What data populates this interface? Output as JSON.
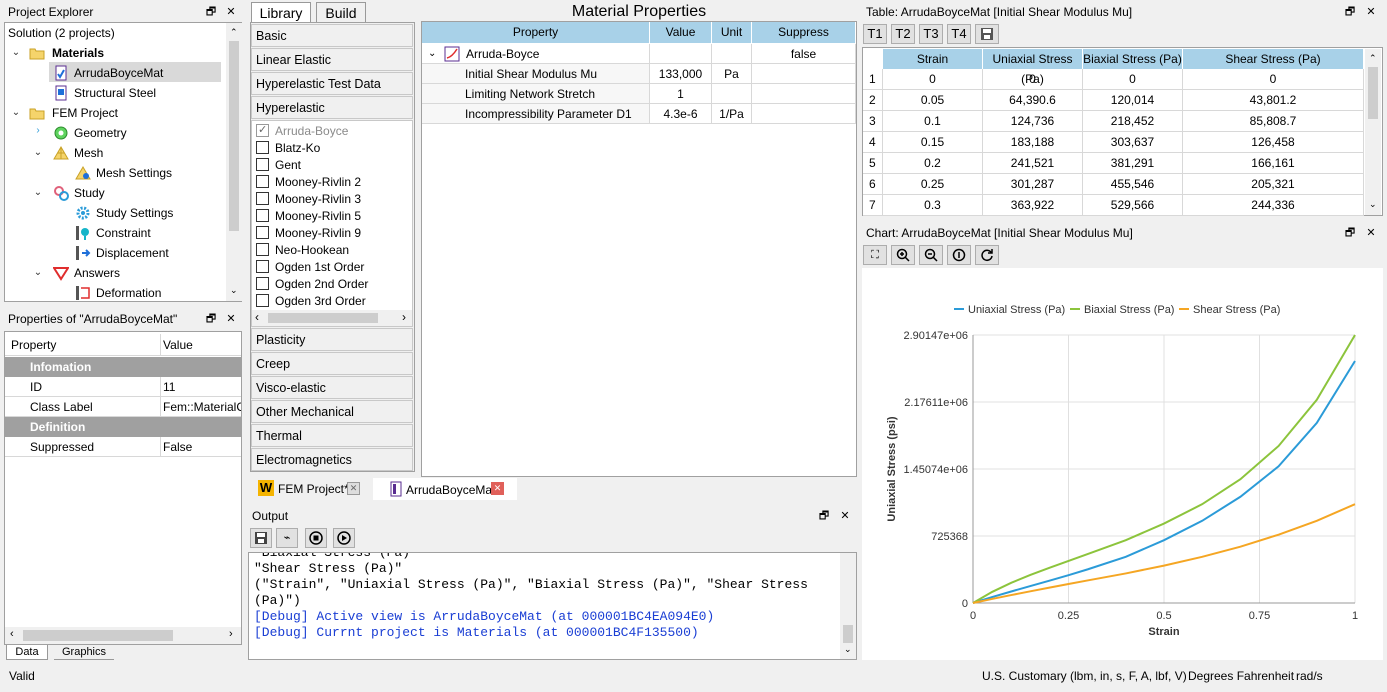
{
  "explorer": {
    "title": "Project Explorer",
    "root": "Solution (2 projects)",
    "materials": "Materials",
    "mat1": "ArrudaBoyceMat",
    "mat2": "Structural Steel",
    "fem": "FEM Project",
    "geometry": "Geometry",
    "mesh": "Mesh",
    "mesh_settings": "Mesh Settings",
    "study": "Study",
    "study_settings": "Study Settings",
    "constraint": "Constraint",
    "displacement": "Displacement",
    "answers": "Answers",
    "deformation": "Deformation"
  },
  "props": {
    "title": "Properties of \"ArrudaBoyceMat\"",
    "col_property": "Property",
    "col_value": "Value",
    "group1": "Infomation",
    "id_label": "ID",
    "id_value": "11",
    "class_label": "Class Label",
    "class_value": "Fem::MaterialC",
    "group2": "Definition",
    "suppressed_label": "Suppressed",
    "suppressed_value": "False",
    "tab_data": "Data",
    "tab_graphics": "Graphics"
  },
  "library": {
    "tab_library": "Library",
    "tab_build": "Build",
    "cats_top": [
      "Basic",
      "Linear Elastic",
      "Hyperelastic Test Data",
      "Hyperelastic"
    ],
    "models": [
      "Arruda-Boyce",
      "Blatz-Ko",
      "Gent",
      "Mooney-Rivlin 2",
      "Mooney-Rivlin 3",
      "Mooney-Rivlin 5",
      "Mooney-Rivlin 9",
      "Neo-Hookean",
      "Ogden 1st Order",
      "Ogden 2nd Order",
      "Ogden 3rd Order"
    ],
    "cats_bottom": [
      "Plasticity",
      "Creep",
      "Visco-elastic",
      "Other Mechanical",
      "Thermal",
      "Electromagnetics"
    ]
  },
  "matprops": {
    "title": "Material Properties",
    "col_property": "Property",
    "col_value": "Value",
    "col_unit": "Unit",
    "col_suppress": "Suppress",
    "model": "Arruda-Boyce",
    "model_suppress": "false",
    "rows": [
      {
        "name": "Initial Shear Modulus Mu",
        "value": "133,000",
        "unit": "Pa"
      },
      {
        "name": "Limiting Network Stretch",
        "value": "1",
        "unit": ""
      },
      {
        "name": "Incompressibility Parameter D1",
        "value": "4.3e-6",
        "unit": "1/Pa"
      }
    ]
  },
  "doctabs": {
    "tab1": "FEM Project*",
    "tab2": "ArrudaBoyceMat"
  },
  "output": {
    "title": "Output",
    "lines": [
      "\"Biaxial Stress (Pa)\"",
      "\"Shear Stress (Pa)\"",
      "(\"Strain\", \"Uniaxial Stress (Pa)\", \"Biaxial Stress (Pa)\", \"Shear Stress",
      "(Pa)\")",
      "[Debug] Active view is ArrudaBoyceMat (at 000001BC4EA094E0)",
      "[Debug] Currnt project is Materials (at 000001BC4F135500)"
    ]
  },
  "table": {
    "title": "Table: ArrudaBoyceMat [Initial Shear Modulus Mu]",
    "tabs": [
      "T1",
      "T2",
      "T3",
      "T4"
    ],
    "headers": [
      "Strain",
      "Uniaxial Stress (Pa)",
      "Biaxial Stress (Pa)",
      "Shear Stress (Pa)"
    ],
    "rows": [
      [
        "1",
        "0",
        "0",
        "0",
        "0"
      ],
      [
        "2",
        "0.05",
        "64,390.6",
        "120,014",
        "43,801.2"
      ],
      [
        "3",
        "0.1",
        "124,736",
        "218,452",
        "85,808.7"
      ],
      [
        "4",
        "0.15",
        "183,188",
        "303,637",
        "126,458"
      ],
      [
        "5",
        "0.2",
        "241,521",
        "381,291",
        "166,161"
      ],
      [
        "6",
        "0.25",
        "301,287",
        "455,546",
        "205,321"
      ],
      [
        "7",
        "0.3",
        "363,922",
        "529,566",
        "244,336"
      ]
    ]
  },
  "chart_panel": {
    "title": "Chart: ArrudaBoyceMat [Initial Shear Modulus Mu]"
  },
  "chart_data": {
    "type": "line",
    "xlabel": "Strain",
    "ylabel": "Uniaxial Stress (psi)",
    "xlim": [
      0,
      1
    ],
    "ylim": [
      0,
      2901470
    ],
    "x_ticks": [
      "0",
      "0.25",
      "0.5",
      "0.75",
      "1"
    ],
    "y_ticks": [
      "0",
      "725368",
      "1.45074e+06",
      "2.17611e+06",
      "2.90147e+06"
    ],
    "legend_position": "top",
    "x": [
      0,
      0.05,
      0.1,
      0.15,
      0.2,
      0.25,
      0.3,
      0.4,
      0.5,
      0.6,
      0.7,
      0.8,
      0.9,
      1.0
    ],
    "series": [
      {
        "name": "Uniaxial Stress (Pa)",
        "color": "#2b9bd8",
        "values": [
          0,
          64390.6,
          124736,
          183188,
          241521,
          301287,
          363922,
          500000,
          680000,
          890000,
          1150000,
          1480000,
          1950000,
          2620000
        ]
      },
      {
        "name": "Biaxial Stress (Pa)",
        "color": "#8cc43c",
        "values": [
          0,
          120014,
          218452,
          303637,
          381291,
          455546,
          529566,
          680000,
          860000,
          1070000,
          1340000,
          1700000,
          2200000,
          2901470
        ]
      },
      {
        "name": "Shear Stress (Pa)",
        "color": "#f5a623",
        "values": [
          0,
          43801.2,
          85808.7,
          126458,
          166161,
          205321,
          244336,
          320000,
          405000,
          500000,
          610000,
          740000,
          890000,
          1070000
        ]
      }
    ]
  },
  "status": {
    "left": "Valid",
    "units": "U.S. Customary (lbm, in, s, F, A, lbf, V)",
    "temp": "Degrees Fahrenheit",
    "angle": "rad/s"
  }
}
